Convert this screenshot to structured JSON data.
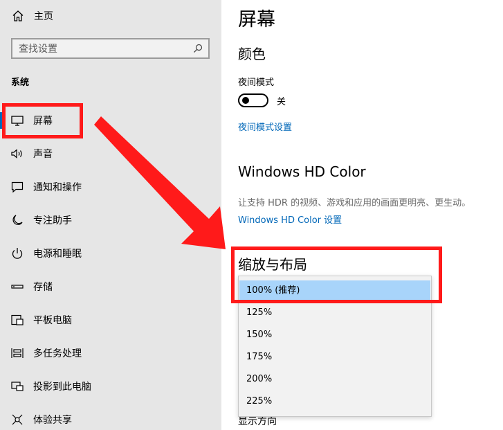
{
  "sidebar": {
    "home": {
      "label": "主页",
      "icon": "home-icon"
    },
    "search": {
      "placeholder": "查找设置",
      "icon": "search-icon"
    },
    "section": "系统",
    "items": [
      {
        "label": "屏幕",
        "icon": "monitor-icon",
        "active": true
      },
      {
        "label": "声音",
        "icon": "speaker-icon"
      },
      {
        "label": "通知和操作",
        "icon": "message-icon"
      },
      {
        "label": "专注助手",
        "icon": "moon-icon"
      },
      {
        "label": "电源和睡眠",
        "icon": "power-icon"
      },
      {
        "label": "存储",
        "icon": "storage-icon"
      },
      {
        "label": "平板电脑",
        "icon": "tablet-icon"
      },
      {
        "label": "多任务处理",
        "icon": "multitask-icon"
      },
      {
        "label": "投影到此电脑",
        "icon": "projection-icon"
      },
      {
        "label": "体验共享",
        "icon": "share-icon"
      }
    ]
  },
  "main": {
    "title": "屏幕",
    "color_section": {
      "heading": "颜色",
      "night_mode_label": "夜间模式",
      "night_mode_state": "关",
      "night_mode_on": false,
      "night_mode_link": "夜间模式设置"
    },
    "hd_color": {
      "heading": "Windows HD Color",
      "description": "让支持 HDR 的视频、游戏和应用的画面更明亮、更生动。",
      "link": "Windows HD Color 设置"
    },
    "scale_layout": {
      "heading": "缩放与布局",
      "options": [
        "100% (推荐)",
        "125%",
        "150%",
        "175%",
        "200%",
        "225%"
      ],
      "selected": "100% (推荐)"
    },
    "partially_hidden_text": "显示方向"
  },
  "colors": {
    "sidebar_bg": "#e6e6e6",
    "accent": "#0067b8",
    "link": "#0067b8",
    "selected_option": "#a8d4fa",
    "annotation": "#ff1a1a"
  }
}
